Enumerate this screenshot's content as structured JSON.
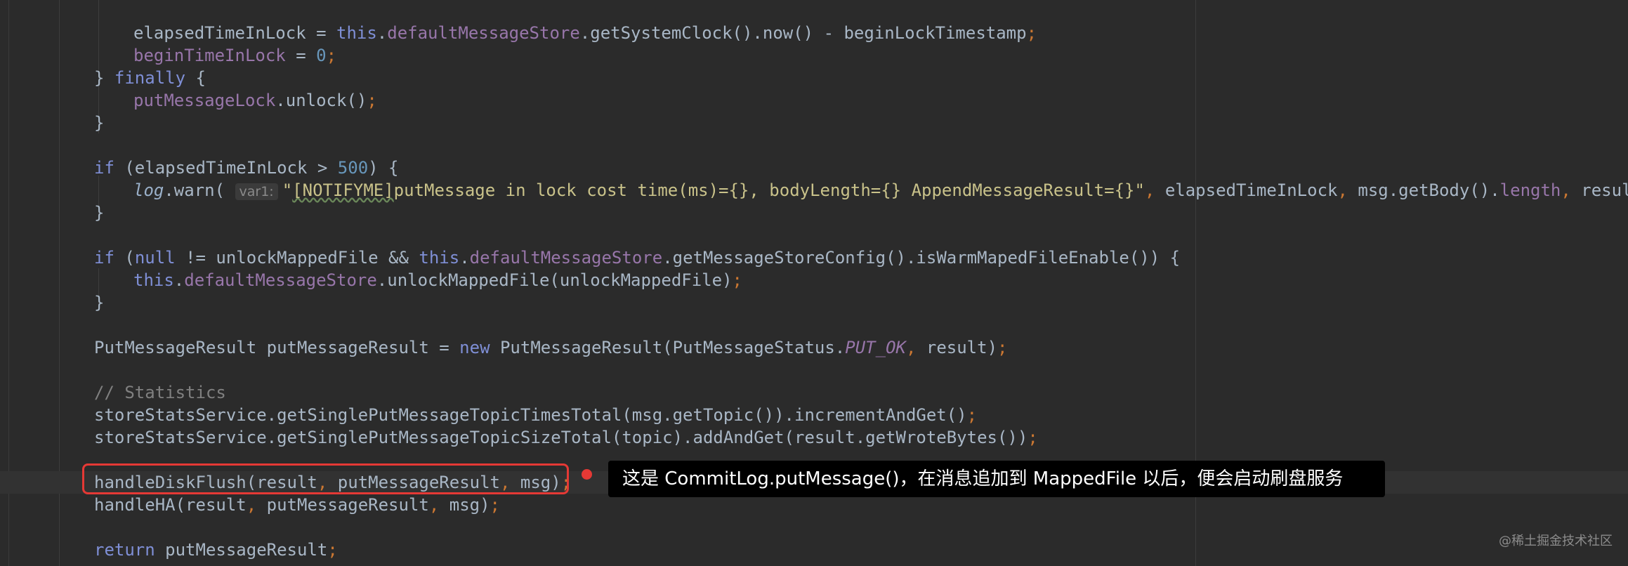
{
  "code": {
    "line1": {
      "var": "elapsedTimeInLock",
      "eq": " = ",
      "this": "this",
      "dot1": ".",
      "field": "defaultMessageStore",
      "rest": ".getSystemClock().now() - beginLockTimestamp",
      "semi": ";"
    },
    "line2": {
      "field": "beginTimeInLock",
      "eq": " = ",
      "num": "0",
      "semi": ";"
    },
    "line3": {
      "open": "} ",
      "kw": "finally",
      "brace": " {"
    },
    "line4": {
      "field": "putMessageLock",
      "rest": ".unlock()",
      "semi": ";"
    },
    "line5": {
      "text": "}"
    },
    "line6": {
      "kw": "if",
      "p1": " (elapsedTimeInLock > ",
      "num": "500",
      "p2": ") {"
    },
    "line7": {
      "log": "log",
      "call": ".warn( ",
      "hint": "var1:",
      "q1": "\"",
      "notify": "[NOTIFYME]",
      "msg": "putMessage in lock cost time(ms)={}, bodyLength={} AppendMessageResult={}\"",
      "comma1": ", ",
      "a1": "elapsedTimeInLock",
      "comma2": ", ",
      "a2": "msg.getBody().",
      "a2f": "length",
      "comma3": ", ",
      "a3": "result)",
      "semi": ";"
    },
    "line8": {
      "text": "}"
    },
    "line9": {
      "kw": "if",
      "p1": " (",
      "null": "null",
      "p2": " != unlockMappedFile && ",
      "this": "this",
      "dot": ".",
      "field": "defaultMessageStore",
      "rest": ".getMessageStoreConfig().isWarmMapedFileEnable()) {"
    },
    "line10": {
      "this": "this",
      "dot": ".",
      "field": "defaultMessageStore",
      "rest": ".unlockMappedFile(unlockMappedFile)",
      "semi": ";"
    },
    "line11": {
      "text": "}"
    },
    "line12": {
      "p1": "PutMessageResult putMessageResult = ",
      "new": "new",
      "p2": " PutMessageResult(PutMessageStatus.",
      "const": "PUT_OK",
      "comma": ", ",
      "p3": "result)",
      "semi": ";"
    },
    "line13": {
      "comment": "// Statistics"
    },
    "line14": {
      "text": "storeStatsService.getSinglePutMessageTopicTimesTotal(msg.getTopic()).incrementAndGet()",
      "semi": ";"
    },
    "line15": {
      "text": "storeStatsService.getSinglePutMessageTopicSizeTotal(topic).addAndGet(result.getWroteBytes())",
      "semi": ";"
    },
    "line16": {
      "p1": "handleDiskFlush(result",
      "c1": ", ",
      "p2": "putMessageResult",
      "c2": ", ",
      "p3": "msg)",
      "semi": ";"
    },
    "line17": {
      "p1": "handleHA(result",
      "c1": ", ",
      "p2": "putMessageResult",
      "c2": ", ",
      "p3": "msg)",
      "semi": ";"
    },
    "line18": {
      "kw": "return",
      "rest": " putMessageResult",
      "semi": ";"
    }
  },
  "annotation": {
    "text": "这是 CommitLog.putMessage()，在消息追加到 MappedFile 以后，便会启动刷盘服务",
    "color": "#e53935"
  },
  "watermark": "@稀土掘金技术社区",
  "theme": {
    "background": "#2b2b2b",
    "keyword": "#cc7832",
    "field": "#9876aa",
    "number": "#6897bb",
    "comment": "#808080",
    "default": "#a9b7c6"
  }
}
